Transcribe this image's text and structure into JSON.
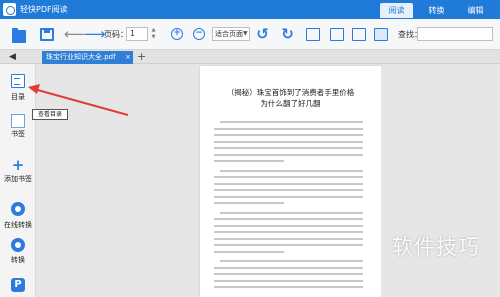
{
  "app": {
    "title": "轻快PDF阅读"
  },
  "topnav": {
    "read": "阅读",
    "convert": "转换",
    "edit": "编辑"
  },
  "toolbar": {
    "page_label": "页码：",
    "page_value": "1",
    "fit_option": "适合页面",
    "search_label": "查找："
  },
  "tabs": {
    "doc_tab": "珠宝行业知识大全.pdf",
    "close": "×",
    "add": "+",
    "collapse": "◀"
  },
  "sidebar": {
    "items": [
      {
        "label": "目录",
        "icon": "toc-icon"
      },
      {
        "label": "书签",
        "icon": "bookmark-icon"
      },
      {
        "label": "添加书签",
        "icon": "add-bookmark-icon"
      },
      {
        "label": "在线转换",
        "icon": "online-convert-icon"
      },
      {
        "label": "转换",
        "icon": "convert-icon"
      },
      {
        "label": "",
        "icon": "pdf-icon"
      }
    ],
    "tooltip": "查看目录"
  },
  "document": {
    "title": "（揭秘）珠宝首饰到了消费者手里价格为什么翻了好几翻"
  },
  "watermark": "软件技巧",
  "colors": {
    "accent": "#1f7ad8",
    "annotation": "#e03a3a"
  }
}
